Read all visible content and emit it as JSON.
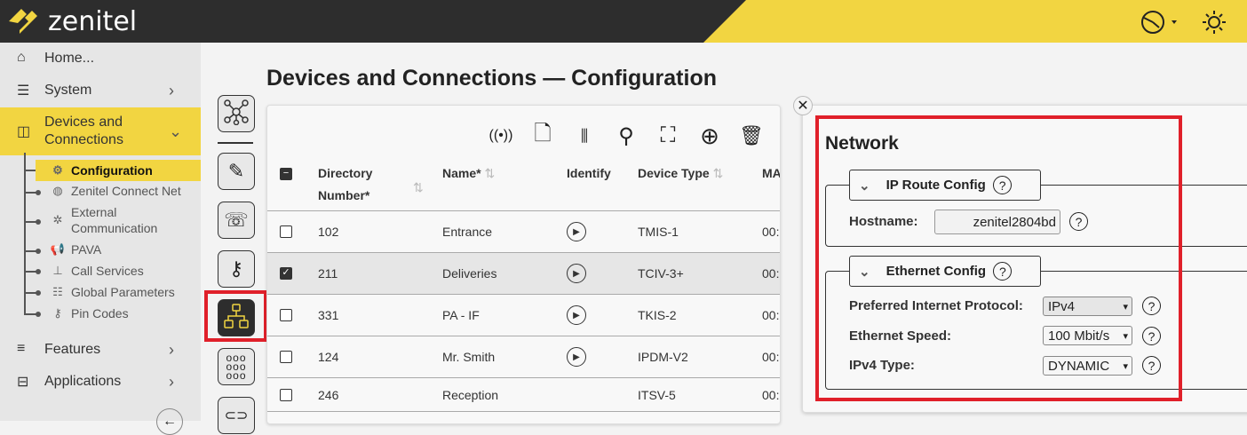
{
  "header": {
    "brand": "zenitel",
    "accent": "#f2d541"
  },
  "sidebar": {
    "items": [
      {
        "label": "Home..."
      },
      {
        "label": "System"
      },
      {
        "label": "Devices and Connections"
      },
      {
        "label": "Features"
      },
      {
        "label": "Applications"
      }
    ],
    "sub_items": [
      {
        "label": "Configuration"
      },
      {
        "label": "Zenitel Connect Net"
      },
      {
        "label": "External Communication"
      },
      {
        "label": "PAVA"
      },
      {
        "label": "Call Services"
      },
      {
        "label": "Global Parameters"
      },
      {
        "label": "Pin Codes"
      }
    ]
  },
  "page": {
    "title": "Devices and Connections — Configuration"
  },
  "table": {
    "columns": {
      "dir": "Directory Number*",
      "name": "Name*",
      "identify": "Identify",
      "type": "Device Type",
      "mac": "MA"
    },
    "rows": [
      {
        "dir": "102",
        "name": "Entrance",
        "type": "TMIS-1",
        "mac": "00:",
        "checked": false
      },
      {
        "dir": "211",
        "name": "Deliveries",
        "type": "TCIV-3+",
        "mac": "00:",
        "checked": true
      },
      {
        "dir": "331",
        "name": "PA - IF",
        "type": "TKIS-2",
        "mac": "00:",
        "checked": false
      },
      {
        "dir": "124",
        "name": "Mr. Smith",
        "type": "IPDM-V2",
        "mac": "00:",
        "checked": false
      },
      {
        "dir": "246",
        "name": "Reception",
        "type": "ITSV-5",
        "mac": "00:",
        "checked": false
      }
    ]
  },
  "network": {
    "title": "Network",
    "ip_route": {
      "legend": "IP Route Config",
      "hostname_label": "Hostname:",
      "hostname": "zenitel2804bd"
    },
    "ethernet": {
      "legend": "Ethernet Config",
      "protocol_label": "Preferred Internet Protocol:",
      "protocol": "IPv4",
      "speed_label": "Ethernet Speed:",
      "speed": "100 Mbit/s",
      "ipv4_label": "IPv4 Type:",
      "ipv4": "DYNAMIC"
    }
  }
}
